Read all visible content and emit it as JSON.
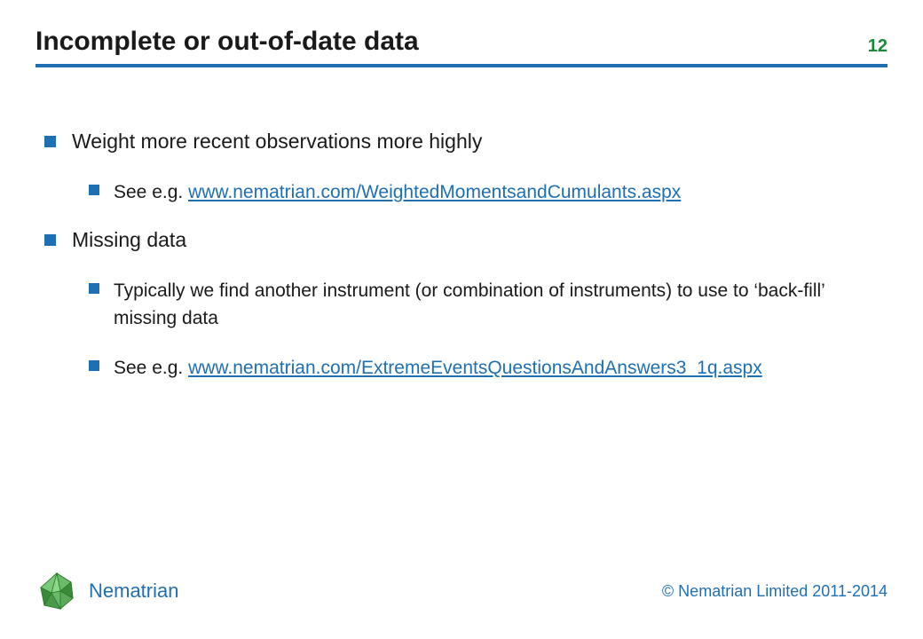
{
  "header": {
    "title": "Incomplete or out-of-date data",
    "page_number": "12"
  },
  "content": {
    "bullets": [
      {
        "level": 1,
        "text": "Weight more recent observations more highly"
      },
      {
        "level": 2,
        "prefix": "See e.g. ",
        "link": "www.nematrian.com/WeightedMomentsandCumulants.aspx"
      },
      {
        "level": 1,
        "text": "Missing data"
      },
      {
        "level": 2,
        "text": "Typically we find another instrument (or combination of instruments) to use to ‘back-fill’ missing data"
      },
      {
        "level": 2,
        "prefix": "See e.g. ",
        "link": "www.nematrian.com/ExtremeEventsQuestionsAndAnswers3_1q.aspx"
      }
    ]
  },
  "footer": {
    "company_name": "Nematrian",
    "copyright": "© Nematrian Limited 2011-2014"
  },
  "colors": {
    "accent_blue": "#1f6fb3",
    "accent_green": "#1a8a3a"
  }
}
